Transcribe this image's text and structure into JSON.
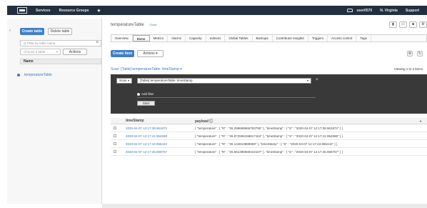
{
  "header": {
    "services": "Services",
    "resource_groups": "Resource Groups",
    "user": "user0570",
    "region": "N. Virginia",
    "support": "Support"
  },
  "sidebar": {
    "create_table": "Create table",
    "delete_table": "Delete table",
    "filter_placeholder": "Q Filter by table name",
    "choose_filter": "Choose a table ...",
    "actions": "Actions",
    "name_header": "Name",
    "tables": [
      "temperatureTable"
    ]
  },
  "main": {
    "title": "temperatureTable",
    "close": "Close",
    "tabs": [
      "Overview",
      "Items",
      "Metrics",
      "Alarms",
      "Capacity",
      "Indexes",
      "Global Tables",
      "Backups",
      "Contributor Insights",
      "Triggers",
      "Access control",
      "Tags"
    ],
    "active_tab": "Items",
    "create_item": "Create item",
    "actions": "Actions",
    "scan_label": "Scan: [Table] temperatureTable: timeStamp",
    "viewing": "Viewing 1 to 4 items",
    "query": {
      "mode": "Scan",
      "target": "[Table] temperatureTable: timeStamp",
      "add_filter": "Add filter",
      "start_search": "Start search"
    },
    "table": {
      "columns": [
        "timeStamp",
        "payload"
      ],
      "rows": [
        {
          "ts": "2020-04-07 12:17:39.961872",
          "payload": "{ \"temperature\" : { \"N\" : \"26.298689566793795\" }, \"timeStamp\" : { \"S\" : \"2020-04-07 12:17:39.961872\" } }"
        },
        {
          "ts": "2020-04-07 12:17:41.964598",
          "payload": "{ \"temperature\" : { \"N\" : \"26.872555158817164\" }, \"timeStamp\" : { \"S\" : \"2020-04-07 12:17:41.964598\" } }"
        },
        {
          "ts": "2020-04-07 12:17:43.966442",
          "payload": "{ \"temperature\" : { \"N\" : \"26.134813889908\" }, \"timeStamp\" : { \"S\" : \"2020-04-07 12:17:43.966442\" } }"
        },
        {
          "ts": "2020-04-07 12:17:45.968757",
          "payload": "{ \"temperature\" : { \"N\" : \"26.561388669422107\" }, \"timeStamp\" : { \"S\" : \"2020-04-07 12:17:45.968757\" } }"
        }
      ]
    }
  },
  "colors": {
    "accent": "#3f7fca",
    "topbar": "#232f3e",
    "query_panel": "#39393a"
  }
}
